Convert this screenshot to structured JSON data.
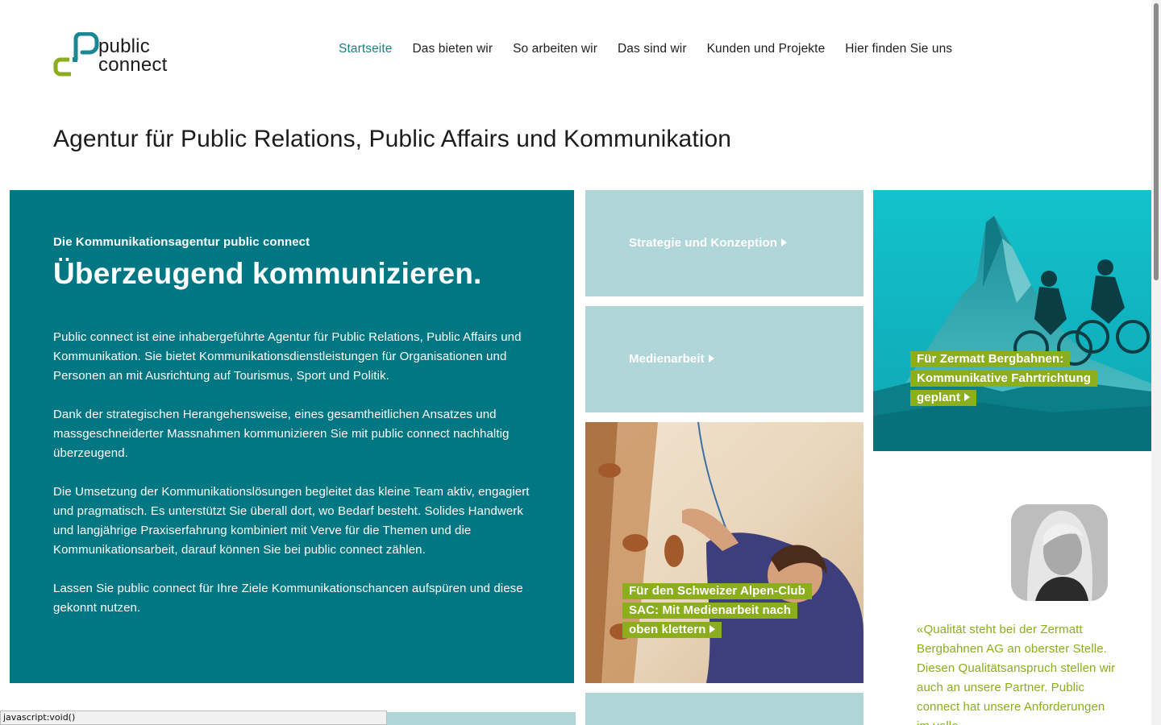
{
  "brand": {
    "line1": "public",
    "line2": "connect",
    "colors": {
      "teal": "#1a8894",
      "lime": "#8aae1c"
    }
  },
  "nav": {
    "items": [
      {
        "label": "Startseite",
        "active": true
      },
      {
        "label": "Das bieten wir"
      },
      {
        "label": "So arbeiten wir"
      },
      {
        "label": "Das sind wir"
      },
      {
        "label": "Kunden und Projekte"
      },
      {
        "label": "Hier finden Sie uns"
      }
    ]
  },
  "page": {
    "title": "Agentur für Public Relations, Public Affairs und Kommunikation"
  },
  "intro": {
    "kicker": "Die Kommunikationsagentur public connect",
    "headline": "Überzeugend kommunizieren.",
    "paragraphs": [
      "Public connect ist eine inhabergeführte Agentur für Public Relations, Public Af­fairs und Kommunikation. Sie bietet Kommunikationsdienstleistungen für Orga­nisationen und Personen an mit Ausrichtung auf Tourismus, Sport und Politik.",
      "Dank der strategischen Herangehensweise, eines gesamtheitlichen Ansatzes und massgeschneiderter Massnahmen kommunizieren Sie mit public connect nachhaltig überzeugend.",
      "Die Umsetzung der Kommunikationslösungen begleitet das kleine Team aktiv, engagiert und pragmatisch. Es unterstützt Sie überall dort, wo Bedarf besteht. Solides Handwerk und langjährige Praxiserfahrung kombiniert mit Verve für die Themen und die Kommunikationsarbeit, darauf können Sie bei public connect zählen.",
      "Lassen Sie public connect für Ihre Ziele Kommunikationschancen aufspüren und diese gekonnt nutzen."
    ]
  },
  "tiles": {
    "strategy": {
      "label": "Strategie und Konzeption"
    },
    "media": {
      "label": "Medienarbeit"
    },
    "zermatt": {
      "lines": [
        "Für Zermatt Bergbahnen:",
        "Kommunikative Fahrtrichtung",
        "geplant"
      ]
    },
    "sac": {
      "lines": [
        "Für den Schweizer Alpen-Club",
        "SAC: Mit Medienarbeit nach",
        "oben klettern"
      ]
    }
  },
  "testimonial": {
    "quote": "«Qualität steht bei der Zermatt Bergbahnen AG an oberster Stelle. Diesen Qualitätsan­spruch stellen wir auch an un­sere Partner. Public connect hat unsere Anforderungen im volle"
  },
  "statusbar": {
    "text": "javascript:void()"
  }
}
